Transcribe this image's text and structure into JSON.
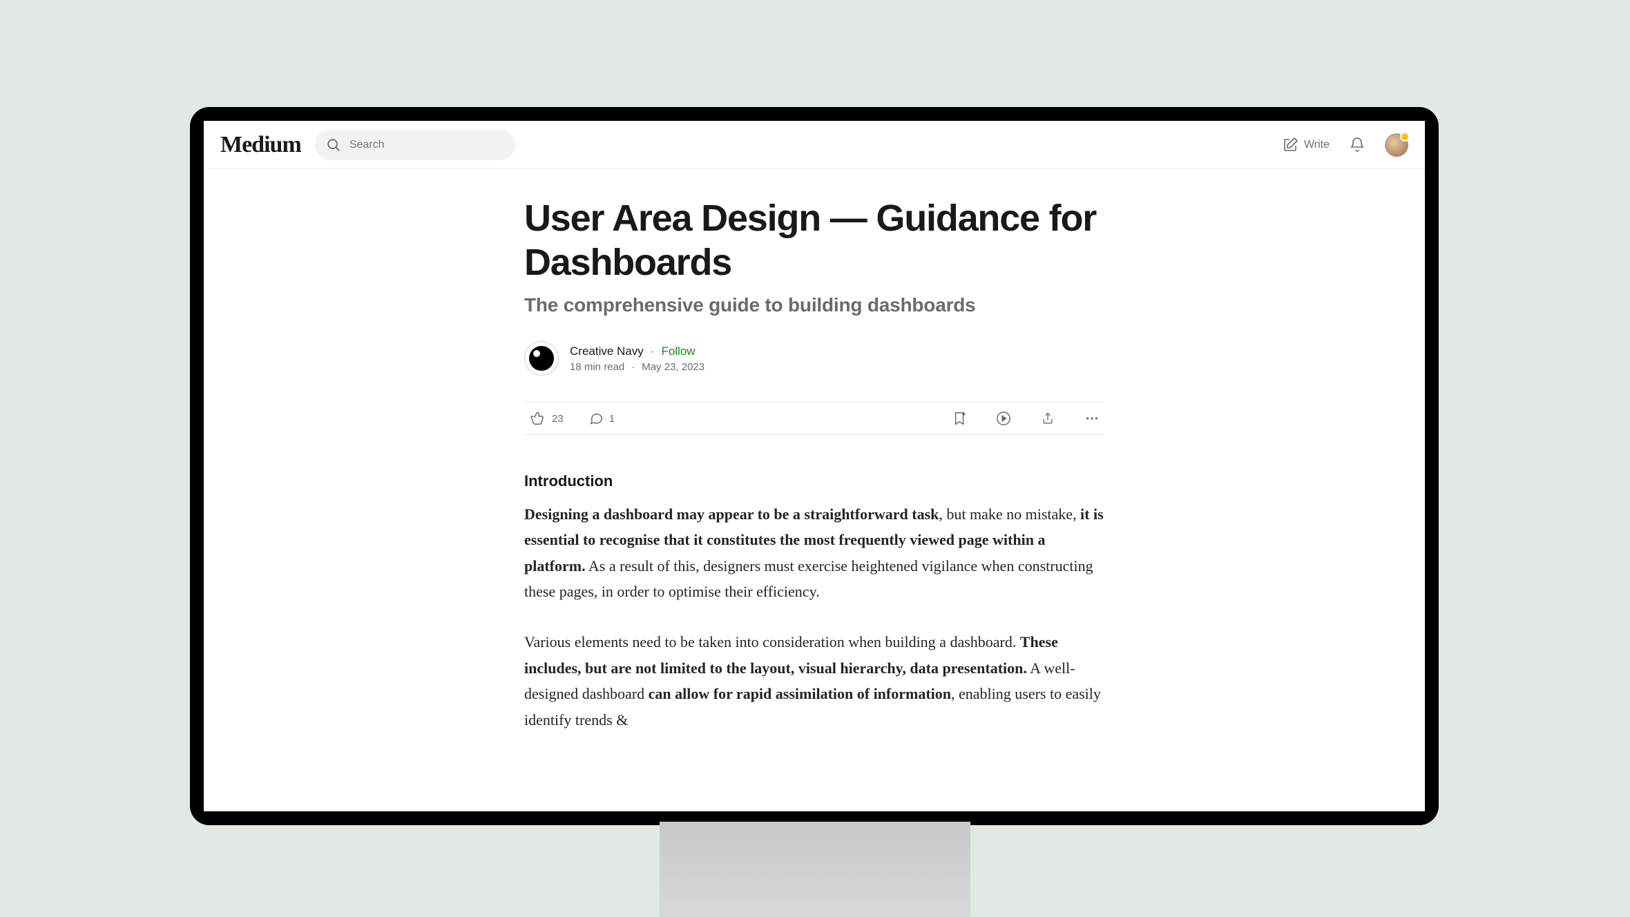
{
  "header": {
    "logo": "Medium",
    "search_placeholder": "Search",
    "write_label": "Write"
  },
  "article": {
    "title": "User Area Design — Guidance for Dashboards",
    "subtitle": "The comprehensive guide to building dashboards",
    "author": "Creative Navy",
    "follow": "Follow",
    "read_time": "18 min read",
    "date": "May 23, 2023",
    "claps": "23",
    "comments": "1",
    "section_heading": "Introduction",
    "p1_b1": "Designing a dashboard may appear to be a straightforward task",
    "p1_t1": ", but make no mistake, ",
    "p1_b2": "it is essential to recognise that it constitutes the most frequently viewed page within a platform.",
    "p1_t2": " As a result of this, designers must exercise heightened vigilance when constructing these pages, in order to optimise their efficiency.",
    "p2_t1": "Various elements need to be taken into consideration when building a dashboard. ",
    "p2_b1": "These includes, but are not limited to the layout, visual hierarchy, data presentation.",
    "p2_t2": " A well-designed dashboard ",
    "p2_b2": "can allow for rapid assimilation of information",
    "p2_t3": ", enabling users to easily identify trends &"
  }
}
